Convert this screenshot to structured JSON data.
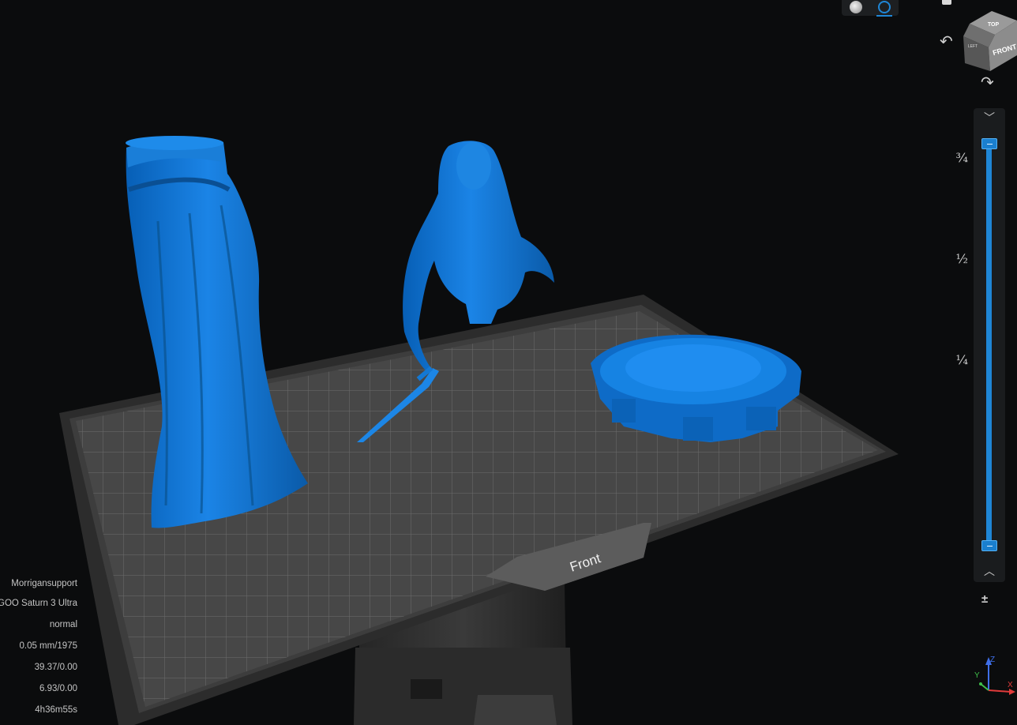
{
  "viewport": {
    "bed_label": "Front",
    "models": [
      "skirt-model",
      "bust-model",
      "base-model"
    ]
  },
  "view_cube": {
    "top_label": "TOP",
    "front_label": "FRONT",
    "left_label": "LEFT"
  },
  "layer_slider": {
    "ticks": [
      "¾",
      "½",
      "¼"
    ],
    "top_value": 1.0,
    "bottom_value": 0.0
  },
  "info": {
    "project": "Morrigansupport",
    "printer": "GOO Saturn 3 Ultra",
    "mode": "normal",
    "layer": "0.05 mm/1975",
    "stat1": "39.37/0.00",
    "stat2": "6.93/0.00",
    "time": "4h36m55s"
  },
  "axes": {
    "x": "X",
    "y": "Y",
    "z": "Z"
  },
  "colors": {
    "model": "#0b6fd1",
    "accent": "#1f86d6",
    "bed": "#4a4a4a"
  },
  "icons": [
    "shaded-view-icon",
    "wireframe-view-icon",
    "rotate-left-icon",
    "rotate-right-icon",
    "chevron-up-icon",
    "chevron-down-icon",
    "layer-height-icon"
  ]
}
